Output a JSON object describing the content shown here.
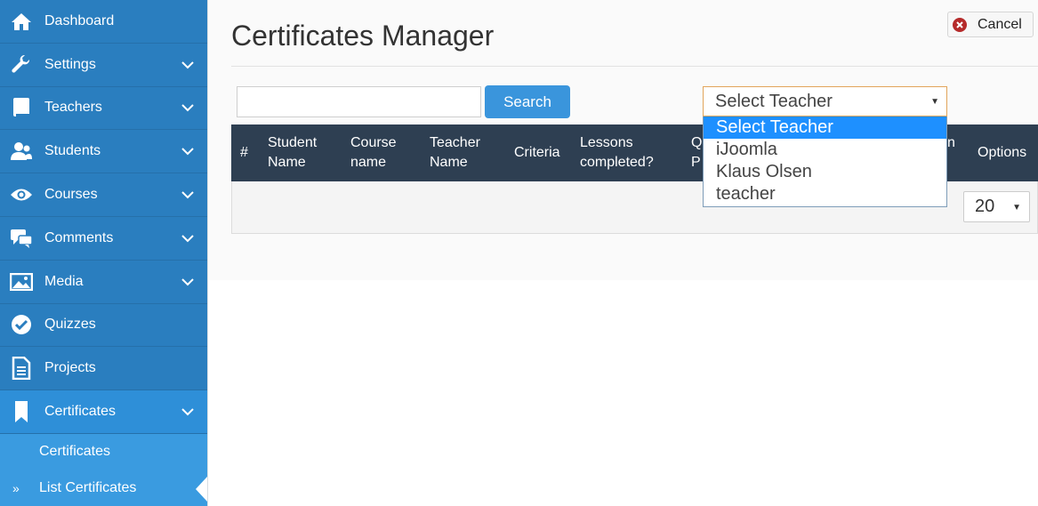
{
  "sidebar": {
    "items": [
      {
        "label": "Dashboard",
        "icon": "home-icon",
        "has_chevron": false
      },
      {
        "label": "Settings",
        "icon": "wrench-icon",
        "has_chevron": true
      },
      {
        "label": "Teachers",
        "icon": "book-icon",
        "has_chevron": true
      },
      {
        "label": "Students",
        "icon": "students-icon",
        "has_chevron": true
      },
      {
        "label": "Courses",
        "icon": "eye-icon",
        "has_chevron": true
      },
      {
        "label": "Comments",
        "icon": "comments-icon",
        "has_chevron": true
      },
      {
        "label": "Media",
        "icon": "image-icon",
        "has_chevron": true
      },
      {
        "label": "Quizzes",
        "icon": "check-circle-icon",
        "has_chevron": false
      },
      {
        "label": "Projects",
        "icon": "document-icon",
        "has_chevron": false
      },
      {
        "label": "Certificates",
        "icon": "bookmark-icon",
        "has_chevron": true
      }
    ],
    "subitems": [
      {
        "label": "Certificates",
        "marker": ""
      },
      {
        "label": "List Certificates",
        "marker": "»"
      }
    ]
  },
  "header": {
    "title": "Certificates Manager",
    "cancel_label": "Cancel"
  },
  "filters": {
    "search_value": "",
    "search_button": "Search",
    "teacher_selected": "Select Teacher",
    "teacher_options": [
      "Select Teacher",
      "iJoomla",
      "Klaus Olsen",
      "teacher"
    ]
  },
  "table": {
    "columns": [
      "#",
      "Student Name",
      "Course name",
      "Teacher Name",
      "Criteria",
      "Lessons completed?",
      "Q P",
      "n",
      "Options"
    ],
    "per_page": "20"
  },
  "colors": {
    "sidebar": "#2a7ebf",
    "sidebar_active_sub": "#3a9be0",
    "table_header": "#2e3f52",
    "primary_button": "#3a95dc",
    "option_highlight": "#1e90ff"
  }
}
